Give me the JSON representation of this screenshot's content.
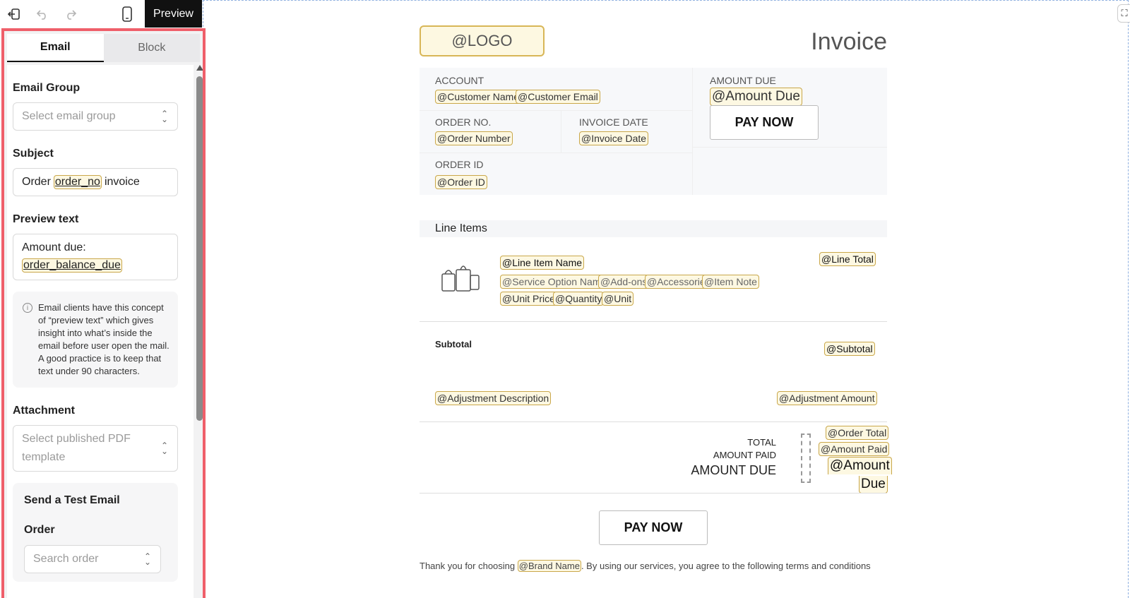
{
  "toolbar": {
    "exit_icon": "exit-icon",
    "undo_icon": "undo-icon",
    "redo_icon": "redo-icon",
    "mobile_icon": "mobile-icon",
    "preview_label": "Preview"
  },
  "panel": {
    "tabs": [
      {
        "label": "Email",
        "active": true
      },
      {
        "label": "Block",
        "active": false
      }
    ],
    "email_group": {
      "label": "Email Group",
      "placeholder": "Select email group"
    },
    "subject": {
      "label": "Subject",
      "prefix": "Order",
      "tag": "order_no",
      "suffix": "invoice"
    },
    "preview_text": {
      "label": "Preview text",
      "prefix": "Amount due:",
      "tag": "order_balance_due"
    },
    "info": "Email clients have this concept of “preview text” which gives insight into what’s inside the email before user open the mail. A good practice is to keep that text under 90 characters.",
    "attachment": {
      "label": "Attachment",
      "placeholder_line1": "Select published PDF",
      "placeholder_line2": "template"
    },
    "test_email": {
      "title": "Send a Test Email",
      "order_label": "Order",
      "order_placeholder": "Search order"
    }
  },
  "invoice": {
    "logo": "@LOGO",
    "title": "Invoice",
    "account_label": "ACCOUNT",
    "customer_name": "@Customer Name",
    "customer_email": "@Customer Email",
    "amount_due_label": "AMOUNT DUE",
    "amount_due_tag": "@Amount Due",
    "pay_now": "PAY NOW",
    "order_no_label": "ORDER NO.",
    "order_number": "@Order Number",
    "invoice_date_label": "INVOICE DATE",
    "invoice_date": "@Invoice Date",
    "order_id_label": "ORDER ID",
    "order_id": "@Order ID",
    "line_items_title": "Line Items",
    "line_item_name": "@Line Item Name",
    "line_total": "@Line Total",
    "service_option": "@Service Option Name",
    "addons": "@Add-ons",
    "accessories": "@Accessories",
    "item_note": "@Item Note",
    "unit_price": "@Unit Price",
    "quantity": "@Quantity",
    "unit": "@Unit",
    "subtotal_label": "Subtotal",
    "subtotal": "@Subtotal",
    "adjustment_description": "@Adjustment Description",
    "adjustment_amount": "@Adjustment Amount",
    "total_label": "TOTAL",
    "amount_paid_label": "AMOUNT PAID",
    "amount_due_big_label": "AMOUNT DUE",
    "order_total": "@Order Total",
    "amount_paid": "@Amount Paid",
    "amount_due_line1": "@Amount",
    "amount_due_line2": "Due",
    "pay_now_bottom": "PAY NOW",
    "footer_prefix": "Thank you for choosing",
    "brand_name": "@Brand Name",
    "footer_suffix": ". By using our services, you agree to the following terms and conditions"
  }
}
